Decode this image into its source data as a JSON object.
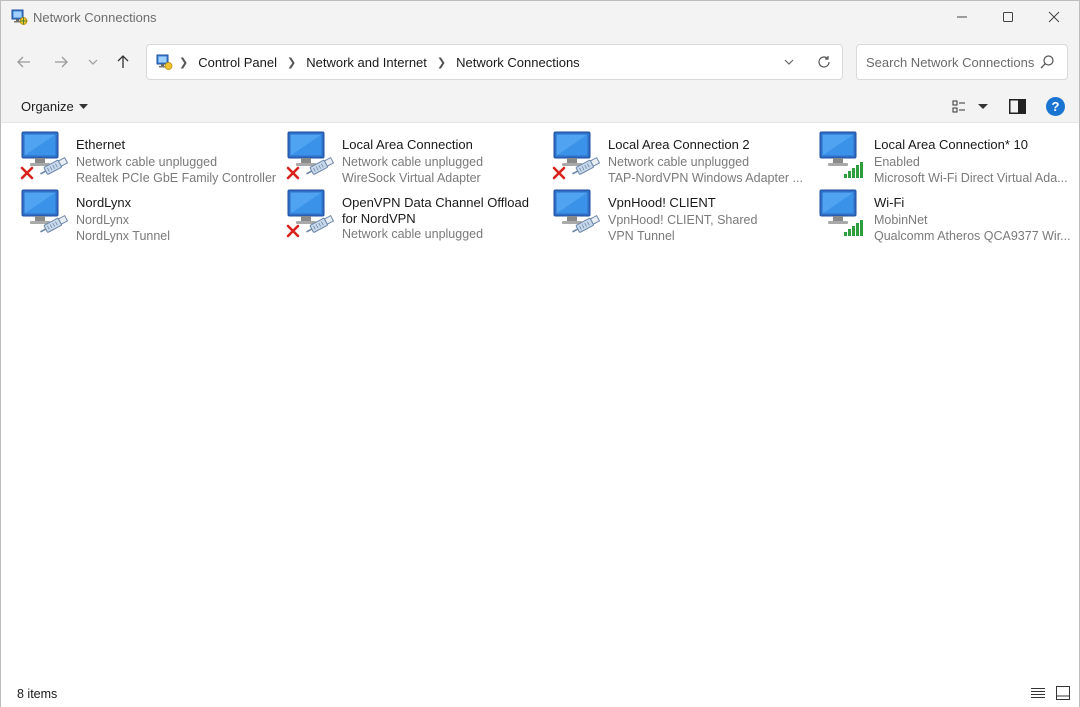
{
  "window": {
    "title": "Network Connections",
    "minimize_icon": "minimize-icon",
    "maximize_icon": "maximize-icon",
    "close_icon": "close-icon"
  },
  "address": {
    "breadcrumbs": [
      "Control Panel",
      "Network and Internet",
      "Network Connections"
    ],
    "search_placeholder": "Search Network Connections"
  },
  "toolbar": {
    "organize_label": "Organize"
  },
  "connections": [
    {
      "name": "Ethernet",
      "status": "Network cable unplugged",
      "device": "Realtek PCIe GbE Family Controller",
      "overlay": "disconnected"
    },
    {
      "name": "Local Area Connection",
      "status": "Network cable unplugged",
      "device": "WireSock Virtual Adapter",
      "overlay": "disconnected"
    },
    {
      "name": "Local Area Connection 2",
      "status": "Network cable unplugged",
      "device": "TAP-NordVPN Windows Adapter ...",
      "overlay": "disconnected"
    },
    {
      "name": "Local Area Connection* 10",
      "status": "Enabled",
      "device": "Microsoft Wi-Fi Direct Virtual Ada...",
      "overlay": "wifi"
    },
    {
      "name": "NordLynx",
      "status": "NordLynx",
      "device": "NordLynx Tunnel",
      "overlay": "cable"
    },
    {
      "name": "OpenVPN Data Channel Offload for NordVPN",
      "status": "Network cable unplugged",
      "device": "",
      "overlay": "disconnected"
    },
    {
      "name": "VpnHood! CLIENT",
      "status": "VpnHood! CLIENT, Shared",
      "device": "VPN Tunnel",
      "overlay": "cable"
    },
    {
      "name": "Wi-Fi",
      "status": "MobinNet",
      "device": "Qualcomm Atheros QCA9377 Wir...",
      "overlay": "wifi"
    }
  ],
  "statusbar": {
    "item_count": "8 items"
  },
  "colors": {
    "chrome": "#f3f3f3",
    "accent": "#1a75d2",
    "error": "#d9221c",
    "signal": "#2e9e3e"
  }
}
